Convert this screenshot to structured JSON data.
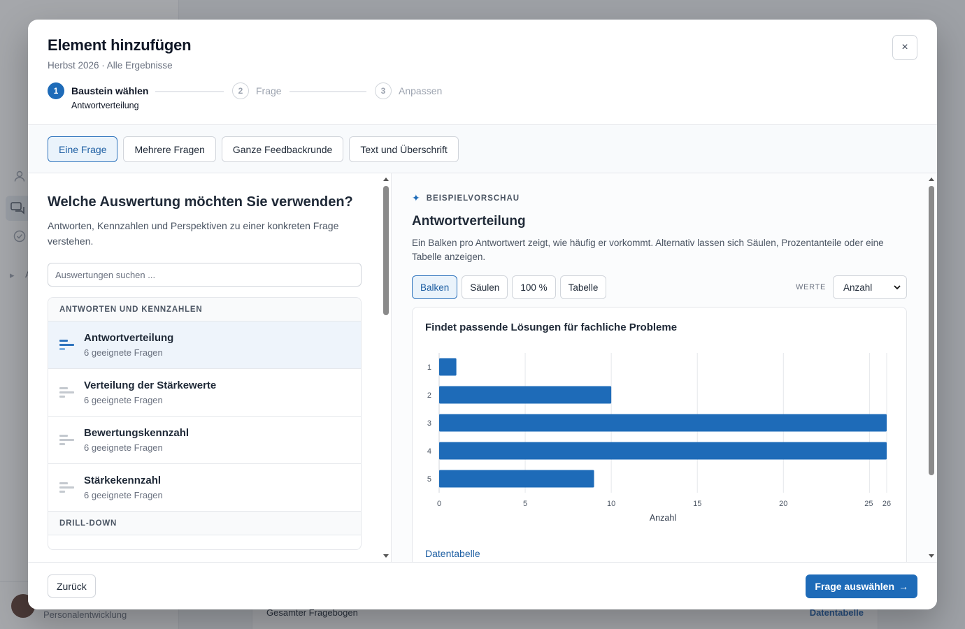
{
  "background": {
    "footer_user_text": "Personalentwicklung",
    "card_left": "Gesamter Fragebogen",
    "card_right": "Datentabelle",
    "nav_letter": "A"
  },
  "modal": {
    "title": "Element hinzufügen",
    "subtitle": "Herbst 2026 · Alle Ergebnisse",
    "close_icon": "×",
    "steps": [
      {
        "number": "1",
        "label": "Baustein wählen",
        "detail": "Antwortverteilung"
      },
      {
        "number": "2",
        "label": "Frage"
      },
      {
        "number": "3",
        "label": "Anpassen"
      }
    ],
    "tabs": [
      {
        "label": "Eine Frage"
      },
      {
        "label": "Mehrere Fragen"
      },
      {
        "label": "Ganze Feedbackrunde"
      },
      {
        "label": "Text und Überschrift"
      }
    ],
    "left": {
      "heading": "Welche Auswertung möchten Sie verwenden?",
      "description": "Antworten, Kennzahlen und Perspektiven zu einer konkreten Frage verstehen.",
      "search_placeholder": "Auswertungen suchen ...",
      "group1": "ANTWORTEN UND KENNZAHLEN",
      "items": [
        {
          "title": "Antwortverteilung",
          "sub": "6 geeignete Fragen"
        },
        {
          "title": "Verteilung der Stärkewerte",
          "sub": "6 geeignete Fragen"
        },
        {
          "title": "Bewertungskennzahl",
          "sub": "6 geeignete Fragen"
        },
        {
          "title": "Stärkekennzahl",
          "sub": "6 geeignete Fragen"
        }
      ],
      "group2": "DRILL-DOWN"
    },
    "right": {
      "tag": "BEISPIELVORSCHAU",
      "spark_icon": "✦",
      "title": "Antwortverteilung",
      "description": "Ein Balken pro Antwortwert zeigt, wie häufig er vorkommt. Alternativ lassen sich Säulen, Prozentanteile oder eine Tabelle anzeigen.",
      "views": [
        {
          "label": "Balken"
        },
        {
          "label": "Säulen"
        },
        {
          "label": "100 %"
        },
        {
          "label": "Tabelle"
        }
      ],
      "werte_label": "WERTE",
      "werte_value": "Anzahl",
      "data_table_link": "Datentabelle"
    },
    "footer": {
      "back": "Zurück",
      "primary": "Frage auswählen",
      "primary_arrow": "→"
    }
  },
  "chart_data": {
    "type": "bar",
    "orientation": "horizontal",
    "title": "Findet passende Lösungen für fachliche Probleme",
    "categories": [
      "1",
      "2",
      "3",
      "4",
      "5"
    ],
    "values": [
      1,
      10,
      26,
      26,
      9
    ],
    "xlabel": "Anzahl",
    "ylabel": "",
    "xlim": [
      0,
      26
    ],
    "xticks": [
      0,
      5,
      10,
      15,
      20,
      25,
      26
    ],
    "grid": true,
    "color": "#1e6bb8"
  }
}
